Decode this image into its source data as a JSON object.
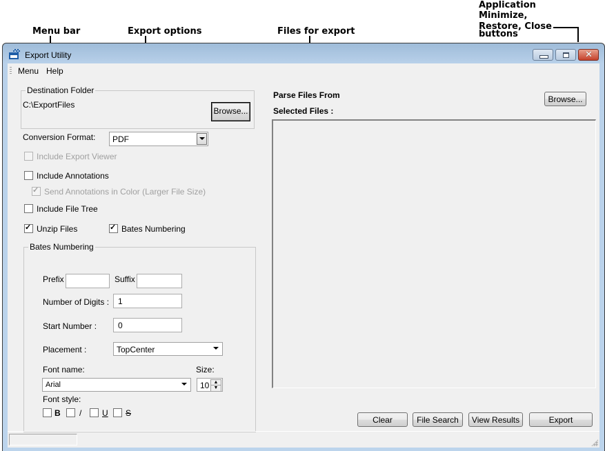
{
  "callouts": {
    "menu_bar": "Menu bar",
    "export_options": "Export options",
    "files_for_export": "Files for export",
    "caption_buttons_line1": "Application",
    "caption_buttons_line2": "Minimize,",
    "caption_buttons_line3": "Restore, Close",
    "caption_buttons_line4": "buttons"
  },
  "window": {
    "title": "Export Utility",
    "icon": "export-utility-app-icon",
    "caption_buttons": [
      "minimize",
      "restore",
      "close"
    ]
  },
  "menu": {
    "items": [
      "Menu",
      "Help"
    ]
  },
  "export_options": {
    "destination_folder": {
      "group_title": "Destination Folder",
      "path": "C:\\ExportFiles",
      "browse_label": "Browse..."
    },
    "conversion_format": {
      "label": "Conversion Format:",
      "selected": "PDF"
    },
    "checkboxes": {
      "include_export_viewer": {
        "label": "Include Export Viewer",
        "checked": false,
        "enabled": false
      },
      "include_annotations": {
        "label": "Include Annotations",
        "checked": false,
        "enabled": true
      },
      "send_annotations_color": {
        "label": "Send Annotations in Color (Larger File Size)",
        "checked": true,
        "enabled": false
      },
      "include_file_tree": {
        "label": "Include File Tree",
        "checked": false,
        "enabled": true
      },
      "unzip_files": {
        "label": "Unzip Files",
        "checked": true,
        "enabled": true
      },
      "bates_numbering": {
        "label": "Bates Numbering",
        "checked": true,
        "enabled": true
      }
    },
    "bates": {
      "group_title": "Bates Numbering",
      "prefix_label": "Prefix",
      "prefix_value": "",
      "suffix_label": "Suffix",
      "suffix_value": "",
      "digits_label": "Number of Digits :",
      "digits_value": "1",
      "start_label": "Start Number :",
      "start_value": "0",
      "placement_label": "Placement :",
      "placement_value": "TopCenter",
      "font_name_label": "Font name:",
      "font_name_value": "Arial",
      "size_label": "Size:",
      "size_value": "10",
      "font_style_label": "Font style:",
      "styles": [
        {
          "label": "B",
          "checked": false
        },
        {
          "label": "/",
          "checked": false
        },
        {
          "label": "U",
          "checked": false
        },
        {
          "label": "S",
          "checked": false
        }
      ]
    }
  },
  "files_panel": {
    "parse_label": "Parse Files From",
    "browse_label": "Browse...",
    "selected_label": "Selected Files :",
    "selected_files": []
  },
  "actions": {
    "clear": "Clear",
    "file_search": "File Search",
    "view_results": "View Results",
    "export": "Export"
  },
  "status": {
    "text": ""
  }
}
